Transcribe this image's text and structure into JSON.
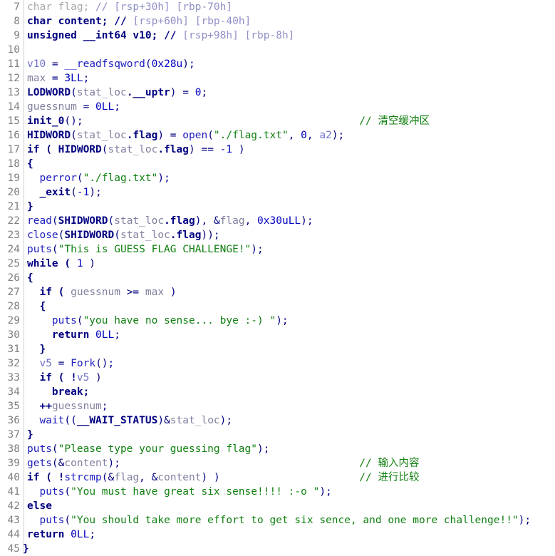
{
  "view": {
    "name": "hexrays-pseudocode-view",
    "first_line": 7,
    "last_line": 45,
    "background": "#ffffff",
    "gutter_divider_color": "#d0d0d0"
  },
  "colors": {
    "keyword": "#000080",
    "function": "#2020c0",
    "global_var": "#8080a0",
    "local_var": "#7070d0",
    "string": "#108010",
    "comment": "#108010",
    "dim_comment": "#9090c8",
    "number": "#0000c0",
    "line_number": "#808080",
    "dimmed_decl": "#a8a8a8"
  },
  "lines": [
    {
      "num": "7",
      "text": "char flag; // [rsp+30h] [rbp-70h]",
      "tokens": [
        {
          "t": "char flag; ",
          "c": "t-dim"
        },
        {
          "t": "// [rsp+30h] [rbp-70h]",
          "c": "t-cmtdim"
        }
      ]
    },
    {
      "num": "8",
      "text": "char content; // [rsp+60h] [rbp-40h]",
      "tokens": [
        {
          "t": "char content; ",
          "c": "t-kw"
        },
        {
          "t": "// ",
          "c": "t-kw"
        },
        {
          "t": "[rsp+60h] [rbp-40h]",
          "c": "t-cmtdim"
        }
      ]
    },
    {
      "num": "9",
      "text": "unsigned __int64 v10; // [rsp+98h] [rbp-8h]",
      "tokens": [
        {
          "t": "unsigned __int64 v10; ",
          "c": "t-kw"
        },
        {
          "t": "// ",
          "c": "t-kw"
        },
        {
          "t": "[rsp+98h] [rbp-8h]",
          "c": "t-cmtdim"
        }
      ]
    },
    {
      "num": "10",
      "text": "",
      "tokens": []
    },
    {
      "num": "11",
      "text": "v10 = __readfsqword(0x28u);",
      "tokens": [
        {
          "t": "v10",
          "c": "t-lvar"
        },
        {
          "t": " = ",
          "c": "t-plain"
        },
        {
          "t": "__readfsqword",
          "c": "t-fn"
        },
        {
          "t": "(",
          "c": "t-plain"
        },
        {
          "t": "0x28u",
          "c": "t-num"
        },
        {
          "t": ");",
          "c": "t-plain"
        }
      ]
    },
    {
      "num": "12",
      "text": "max = 3LL;",
      "tokens": [
        {
          "t": "max",
          "c": "t-var"
        },
        {
          "t": " = ",
          "c": "t-plain"
        },
        {
          "t": "3LL",
          "c": "t-num"
        },
        {
          "t": ";",
          "c": "t-plain"
        }
      ]
    },
    {
      "num": "13",
      "text": "LODWORD(stat_loc.__uptr) = 0;",
      "tokens": [
        {
          "t": "LODWORD",
          "c": "t-kw"
        },
        {
          "t": "(",
          "c": "t-plain"
        },
        {
          "t": "stat_loc",
          "c": "t-var"
        },
        {
          "t": ".__uptr",
          "c": "t-kw"
        },
        {
          "t": ") = ",
          "c": "t-plain"
        },
        {
          "t": "0",
          "c": "t-num"
        },
        {
          "t": ";",
          "c": "t-plain"
        }
      ]
    },
    {
      "num": "14",
      "text": "guessnum = 0LL;",
      "tokens": [
        {
          "t": "guessnum",
          "c": "t-var"
        },
        {
          "t": " = ",
          "c": "t-plain"
        },
        {
          "t": "0LL",
          "c": "t-num"
        },
        {
          "t": ";",
          "c": "t-plain"
        }
      ]
    },
    {
      "num": "15",
      "text": "init_0();",
      "comment": "// 清空缓冲区",
      "comment_col": 57,
      "tokens": [
        {
          "t": "init_0",
          "c": "t-kw"
        },
        {
          "t": "();",
          "c": "t-plain"
        }
      ]
    },
    {
      "num": "16",
      "text": "HIDWORD(stat_loc.flag) = open(\"./flag.txt\", 0, a2);",
      "tokens": [
        {
          "t": "HIDWORD",
          "c": "t-kw"
        },
        {
          "t": "(",
          "c": "t-plain"
        },
        {
          "t": "stat_loc",
          "c": "t-var"
        },
        {
          "t": ".flag",
          "c": "t-kw"
        },
        {
          "t": ") = ",
          "c": "t-plain"
        },
        {
          "t": "open",
          "c": "t-fn"
        },
        {
          "t": "(",
          "c": "t-plain"
        },
        {
          "t": "\"./flag.txt\"",
          "c": "t-str"
        },
        {
          "t": ", ",
          "c": "t-plain"
        },
        {
          "t": "0",
          "c": "t-num"
        },
        {
          "t": ", ",
          "c": "t-plain"
        },
        {
          "t": "a2",
          "c": "t-lvar"
        },
        {
          "t": ");",
          "c": "t-plain"
        }
      ]
    },
    {
      "num": "17",
      "text": "if ( HIDWORD(stat_loc.flag) == -1 )",
      "tokens": [
        {
          "t": "if ( ",
          "c": "t-kw"
        },
        {
          "t": "HIDWORD",
          "c": "t-kw"
        },
        {
          "t": "(",
          "c": "t-plain"
        },
        {
          "t": "stat_loc",
          "c": "t-var"
        },
        {
          "t": ".flag",
          "c": "t-kw"
        },
        {
          "t": ") == ",
          "c": "t-plain"
        },
        {
          "t": "-1",
          "c": "t-num"
        },
        {
          "t": " )",
          "c": "t-plain"
        }
      ]
    },
    {
      "num": "18",
      "text": "{",
      "tokens": [
        {
          "t": "{",
          "c": "t-kw"
        }
      ]
    },
    {
      "num": "19",
      "text": "  perror(\"./flag.txt\");",
      "tokens": [
        {
          "t": "  ",
          "c": "t-plain"
        },
        {
          "t": "perror",
          "c": "t-fn"
        },
        {
          "t": "(",
          "c": "t-plain"
        },
        {
          "t": "\"./flag.txt\"",
          "c": "t-str"
        },
        {
          "t": ");",
          "c": "t-plain"
        }
      ]
    },
    {
      "num": "20",
      "text": "  _exit(-1);",
      "tokens": [
        {
          "t": "  ",
          "c": "t-plain"
        },
        {
          "t": "_exit",
          "c": "t-kw"
        },
        {
          "t": "(",
          "c": "t-plain"
        },
        {
          "t": "-1",
          "c": "t-num"
        },
        {
          "t": ");",
          "c": "t-plain"
        }
      ]
    },
    {
      "num": "21",
      "text": "}",
      "tokens": [
        {
          "t": "}",
          "c": "t-kw"
        }
      ]
    },
    {
      "num": "22",
      "text": "read(SHIDWORD(stat_loc.flag), &flag, 0x30uLL);",
      "tokens": [
        {
          "t": "read",
          "c": "t-fn"
        },
        {
          "t": "(",
          "c": "t-plain"
        },
        {
          "t": "SHIDWORD",
          "c": "t-kw"
        },
        {
          "t": "(",
          "c": "t-plain"
        },
        {
          "t": "stat_loc",
          "c": "t-var"
        },
        {
          "t": ".flag",
          "c": "t-kw"
        },
        {
          "t": "), &",
          "c": "t-plain"
        },
        {
          "t": "flag",
          "c": "t-var"
        },
        {
          "t": ", ",
          "c": "t-plain"
        },
        {
          "t": "0x30uLL",
          "c": "t-num"
        },
        {
          "t": ");",
          "c": "t-plain"
        }
      ]
    },
    {
      "num": "23",
      "text": "close(SHIDWORD(stat_loc.flag));",
      "tokens": [
        {
          "t": "close",
          "c": "t-fn"
        },
        {
          "t": "(",
          "c": "t-plain"
        },
        {
          "t": "SHIDWORD",
          "c": "t-kw"
        },
        {
          "t": "(",
          "c": "t-plain"
        },
        {
          "t": "stat_loc",
          "c": "t-var"
        },
        {
          "t": ".flag",
          "c": "t-kw"
        },
        {
          "t": "));",
          "c": "t-plain"
        }
      ]
    },
    {
      "num": "24",
      "text": "puts(\"This is GUESS FLAG CHALLENGE!\");",
      "tokens": [
        {
          "t": "puts",
          "c": "t-fn"
        },
        {
          "t": "(",
          "c": "t-plain"
        },
        {
          "t": "\"This is GUESS FLAG CHALLENGE!\"",
          "c": "t-str"
        },
        {
          "t": ");",
          "c": "t-plain"
        }
      ]
    },
    {
      "num": "25",
      "text": "while ( 1 )",
      "tokens": [
        {
          "t": "while ( ",
          "c": "t-kw"
        },
        {
          "t": "1",
          "c": "t-num"
        },
        {
          "t": " )",
          "c": "t-plain"
        }
      ]
    },
    {
      "num": "26",
      "text": "{",
      "tokens": [
        {
          "t": "{",
          "c": "t-kw"
        }
      ]
    },
    {
      "num": "27",
      "text": "  if ( guessnum >= max )",
      "tokens": [
        {
          "t": "  ",
          "c": "t-plain"
        },
        {
          "t": "if ( ",
          "c": "t-kw"
        },
        {
          "t": "guessnum",
          "c": "t-var"
        },
        {
          "t": " >= ",
          "c": "t-plain"
        },
        {
          "t": "max",
          "c": "t-var"
        },
        {
          "t": " )",
          "c": "t-plain"
        }
      ]
    },
    {
      "num": "28",
      "text": "  {",
      "tokens": [
        {
          "t": "  {",
          "c": "t-kw"
        }
      ]
    },
    {
      "num": "29",
      "text": "    puts(\"you have no sense... bye :-) \");",
      "tokens": [
        {
          "t": "    ",
          "c": "t-plain"
        },
        {
          "t": "puts",
          "c": "t-fn"
        },
        {
          "t": "(",
          "c": "t-plain"
        },
        {
          "t": "\"you have no sense... bye :-) \"",
          "c": "t-str"
        },
        {
          "t": ");",
          "c": "t-plain"
        }
      ]
    },
    {
      "num": "30",
      "text": "    return 0LL;",
      "tokens": [
        {
          "t": "    ",
          "c": "t-plain"
        },
        {
          "t": "return ",
          "c": "t-kw"
        },
        {
          "t": "0LL",
          "c": "t-num"
        },
        {
          "t": ";",
          "c": "t-plain"
        }
      ]
    },
    {
      "num": "31",
      "text": "  }",
      "tokens": [
        {
          "t": "  }",
          "c": "t-kw"
        }
      ]
    },
    {
      "num": "32",
      "text": "  v5 = Fork();",
      "tokens": [
        {
          "t": "  ",
          "c": "t-plain"
        },
        {
          "t": "v5",
          "c": "t-lvar"
        },
        {
          "t": " = ",
          "c": "t-plain"
        },
        {
          "t": "Fork",
          "c": "t-fn"
        },
        {
          "t": "();",
          "c": "t-plain"
        }
      ]
    },
    {
      "num": "33",
      "text": "  if ( !v5 )",
      "tokens": [
        {
          "t": "  ",
          "c": "t-plain"
        },
        {
          "t": "if ( !",
          "c": "t-kw"
        },
        {
          "t": "v5",
          "c": "t-lvar"
        },
        {
          "t": " )",
          "c": "t-plain"
        }
      ]
    },
    {
      "num": "34",
      "text": "    break;",
      "tokens": [
        {
          "t": "    ",
          "c": "t-plain"
        },
        {
          "t": "break;",
          "c": "t-kw"
        }
      ]
    },
    {
      "num": "35",
      "text": "  ++guessnum;",
      "tokens": [
        {
          "t": "  ",
          "c": "t-plain"
        },
        {
          "t": "++",
          "c": "t-op"
        },
        {
          "t": "guessnum",
          "c": "t-var"
        },
        {
          "t": ";",
          "c": "t-plain"
        }
      ]
    },
    {
      "num": "36",
      "text": "  wait((__WAIT_STATUS)&stat_loc);",
      "tokens": [
        {
          "t": "  ",
          "c": "t-plain"
        },
        {
          "t": "wait",
          "c": "t-fn"
        },
        {
          "t": "((",
          "c": "t-plain"
        },
        {
          "t": "__WAIT_STATUS",
          "c": "t-kw"
        },
        {
          "t": ")&",
          "c": "t-plain"
        },
        {
          "t": "stat_loc",
          "c": "t-var"
        },
        {
          "t": ");",
          "c": "t-plain"
        }
      ]
    },
    {
      "num": "37",
      "text": "}",
      "tokens": [
        {
          "t": "}",
          "c": "t-kw"
        }
      ]
    },
    {
      "num": "38",
      "text": "puts(\"Please type your guessing flag\");",
      "tokens": [
        {
          "t": "puts",
          "c": "t-fn"
        },
        {
          "t": "(",
          "c": "t-plain"
        },
        {
          "t": "\"Please type your guessing flag\"",
          "c": "t-str"
        },
        {
          "t": ");",
          "c": "t-plain"
        }
      ]
    },
    {
      "num": "39",
      "text": "gets(&content);",
      "comment": "// 输入内容",
      "comment_col": 57,
      "tokens": [
        {
          "t": "gets",
          "c": "t-fn"
        },
        {
          "t": "(&",
          "c": "t-plain"
        },
        {
          "t": "content",
          "c": "t-var"
        },
        {
          "t": ");",
          "c": "t-plain"
        }
      ]
    },
    {
      "num": "40",
      "text": "if ( !strcmp(&flag, &content) )",
      "comment": "// 进行比较",
      "comment_col": 57,
      "tokens": [
        {
          "t": "if ( !",
          "c": "t-kw"
        },
        {
          "t": "strcmp",
          "c": "t-fn"
        },
        {
          "t": "(&",
          "c": "t-plain"
        },
        {
          "t": "flag",
          "c": "t-var"
        },
        {
          "t": ", &",
          "c": "t-plain"
        },
        {
          "t": "content",
          "c": "t-var"
        },
        {
          "t": ") )",
          "c": "t-plain"
        }
      ]
    },
    {
      "num": "41",
      "text": "  puts(\"You must have great six sense!!!! :-o \");",
      "tokens": [
        {
          "t": "  ",
          "c": "t-plain"
        },
        {
          "t": "puts",
          "c": "t-fn"
        },
        {
          "t": "(",
          "c": "t-plain"
        },
        {
          "t": "\"You must have great six sense!!!! :-o \"",
          "c": "t-str"
        },
        {
          "t": ");",
          "c": "t-plain"
        }
      ]
    },
    {
      "num": "42",
      "text": "else",
      "tokens": [
        {
          "t": "else",
          "c": "t-kw"
        }
      ]
    },
    {
      "num": "43",
      "text": "  puts(\"You should take more effort to get six sence, and one more challenge!!\");",
      "tokens": [
        {
          "t": "  ",
          "c": "t-plain"
        },
        {
          "t": "puts",
          "c": "t-fn"
        },
        {
          "t": "(",
          "c": "t-plain"
        },
        {
          "t": "\"You should take more effort to get six sence, and one more challenge!!\"",
          "c": "t-str"
        },
        {
          "t": ");",
          "c": "t-plain"
        }
      ]
    },
    {
      "num": "44",
      "text": "return 0LL;",
      "tokens": [
        {
          "t": "return ",
          "c": "t-kw"
        },
        {
          "t": "0LL",
          "c": "t-num"
        },
        {
          "t": ";",
          "c": "t-plain"
        }
      ]
    },
    {
      "num": "45",
      "text": "}",
      "indent_override": 0,
      "tokens": [
        {
          "t": "}",
          "c": "t-kw"
        }
      ]
    }
  ]
}
